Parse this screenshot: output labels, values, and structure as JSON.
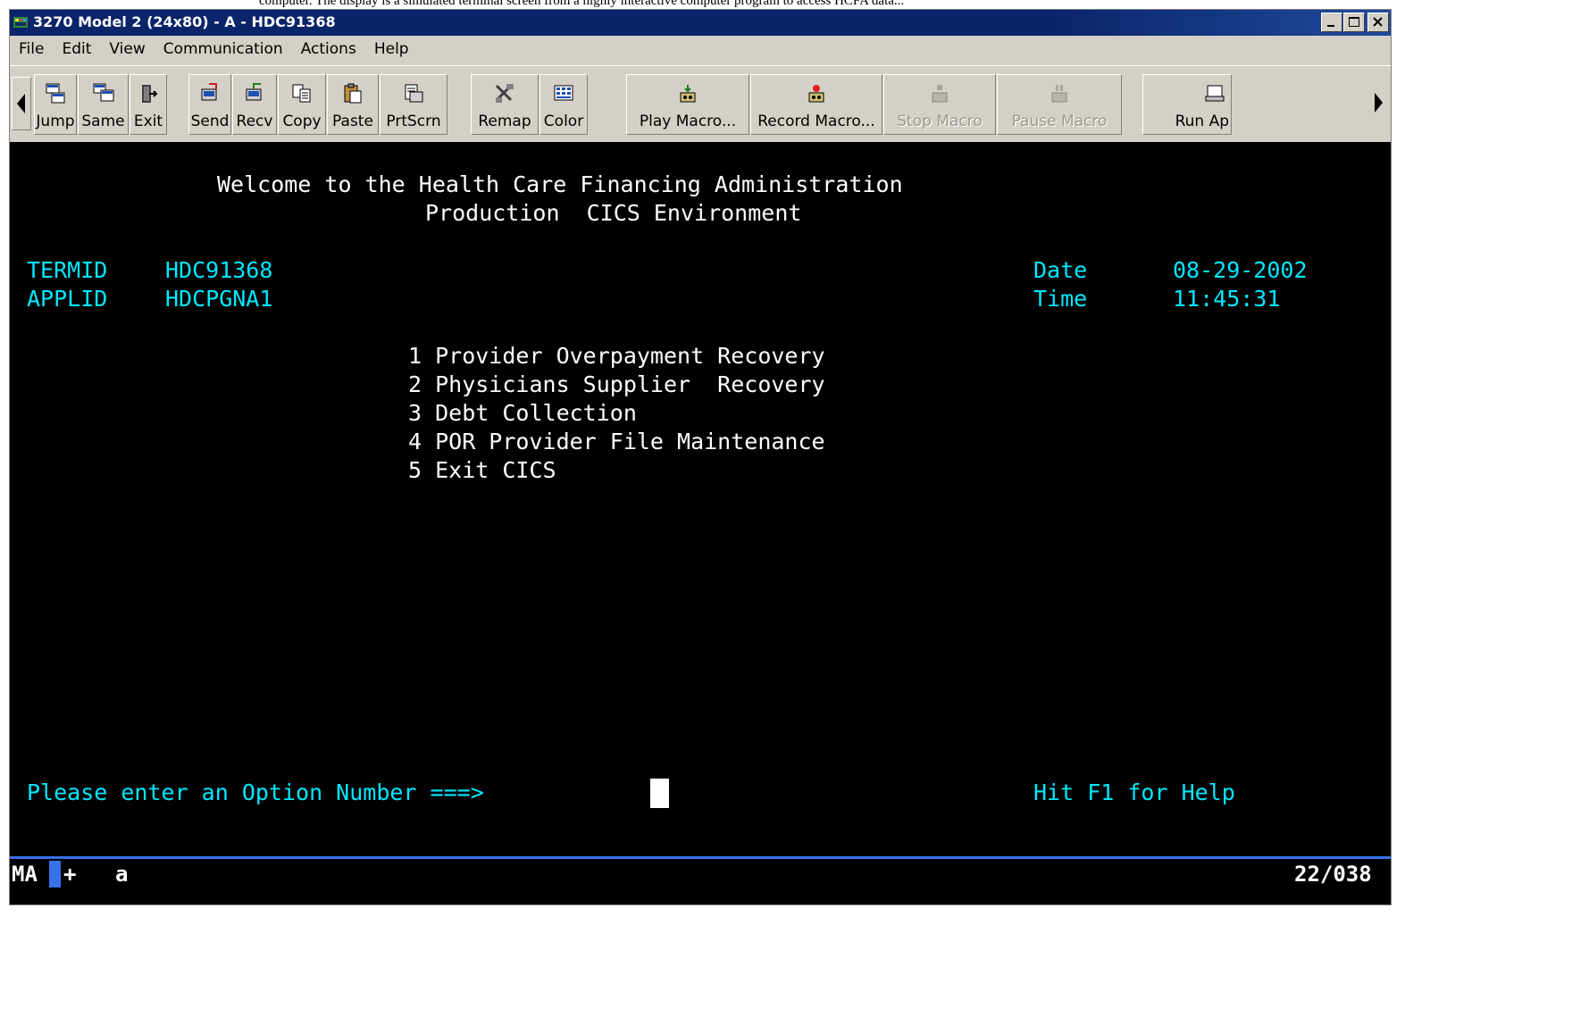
{
  "caption": "computer. The display is a simulated terminal screen from a highly interactive computer program to access HCFA data...",
  "window": {
    "title": "3270 Model 2 (24x80) - A - HDC91368",
    "minimize_label": "_",
    "maximize_label": "□",
    "close_label": "×"
  },
  "menubar": {
    "items": [
      "File",
      "Edit",
      "View",
      "Communication",
      "Actions",
      "Help"
    ]
  },
  "toolbar": {
    "buttons": [
      {
        "label": "Jump",
        "icon": "jump-icon",
        "enabled": true
      },
      {
        "label": "Same",
        "icon": "same-icon",
        "enabled": true
      },
      {
        "label": "Exit",
        "icon": "exit-icon",
        "enabled": true
      },
      {
        "label": "Send",
        "icon": "send-icon",
        "enabled": true
      },
      {
        "label": "Recv",
        "icon": "receive-icon",
        "enabled": true
      },
      {
        "label": "Copy",
        "icon": "copy-icon",
        "enabled": true
      },
      {
        "label": "Paste",
        "icon": "paste-icon",
        "enabled": true
      },
      {
        "label": "PrtScrn",
        "icon": "print-screen-icon",
        "enabled": true
      },
      {
        "label": "Remap",
        "icon": "remap-icon",
        "enabled": true
      },
      {
        "label": "Color",
        "icon": "color-icon",
        "enabled": true
      },
      {
        "label": "Play Macro...",
        "icon": "play-macro-icon",
        "enabled": true
      },
      {
        "label": "Record Macro...",
        "icon": "record-macro-icon",
        "enabled": true
      },
      {
        "label": "Stop Macro",
        "icon": "stop-macro-icon",
        "enabled": false
      },
      {
        "label": "Pause Macro",
        "icon": "pause-macro-icon",
        "enabled": false
      },
      {
        "label": "Run Ap",
        "icon": "run-app-icon",
        "enabled": true
      }
    ]
  },
  "terminal": {
    "welcome_line": "Welcome to the Health Care Financing Administration",
    "env_line": "Production  CICS Environment",
    "termid_label": "TERMID",
    "termid_value": "HDC91368",
    "applid_label": "APPLID",
    "applid_value": "HDCPGNA1",
    "date_label": "Date",
    "date_value": "08-29-2002",
    "time_label": "Time",
    "time_value": "11:45:31",
    "menu_options": [
      "1 Provider Overpayment Recovery",
      "2 Physicians Supplier  Recovery",
      "3 Debt Collection",
      "4 POR Provider File Maintenance",
      "5 Exit CICS"
    ],
    "prompt": "Please enter an Option Number ===>",
    "help_hint": "Hit F1 for Help",
    "colors": {
      "background": "#000000",
      "text": "#ffffff",
      "field": "#00e8ff",
      "status_rule": "#3870e8"
    }
  },
  "status": {
    "mode": "MA",
    "plus": "+",
    "indicator": "a",
    "cursor_pos": "22/038"
  }
}
